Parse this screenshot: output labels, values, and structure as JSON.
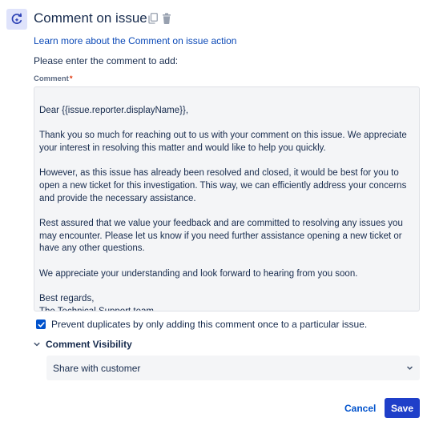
{
  "header": {
    "title": "Comment on issue",
    "action_icon": "comment-refresh-icon",
    "copy_icon": "copy-icon",
    "delete_icon": "trash-icon"
  },
  "help_link": "Learn more about the Comment on issue action",
  "prompt": "Please enter the comment to add:",
  "comment_field": {
    "label": "Comment",
    "required_marker": "*",
    "paragraphs": [
      "Dear {{issue.reporter.displayName}},",
      "Thank you so much for reaching out to us with your comment on this issue. We appreciate your interest in resolving this matter and would like to help you quickly.",
      "However, as this issue has already been resolved and closed, it would be best for you to open a new ticket for this investigation. This way, we can efficiently address your concerns and provide the necessary assistance.",
      "Rest assured that we value your feedback and are committed to resolving any issues you may encounter. Please let us know if you need further assistance opening a new ticket or have any other questions.",
      "We appreciate your understanding and look forward to hearing from you soon.",
      "Best regards,\nThe Technical Support team"
    ]
  },
  "prevent_duplicates": {
    "checked": true,
    "label": "Prevent duplicates by only adding this comment once to a particular issue."
  },
  "visibility": {
    "title": "Comment Visibility",
    "selected": "Share with customer"
  },
  "buttons": {
    "cancel": "Cancel",
    "save": "Save"
  },
  "colors": {
    "primary": "#1f3fc9",
    "link": "#0b49b7",
    "required": "#de350b",
    "icon_bg": "#dfe3fb"
  }
}
